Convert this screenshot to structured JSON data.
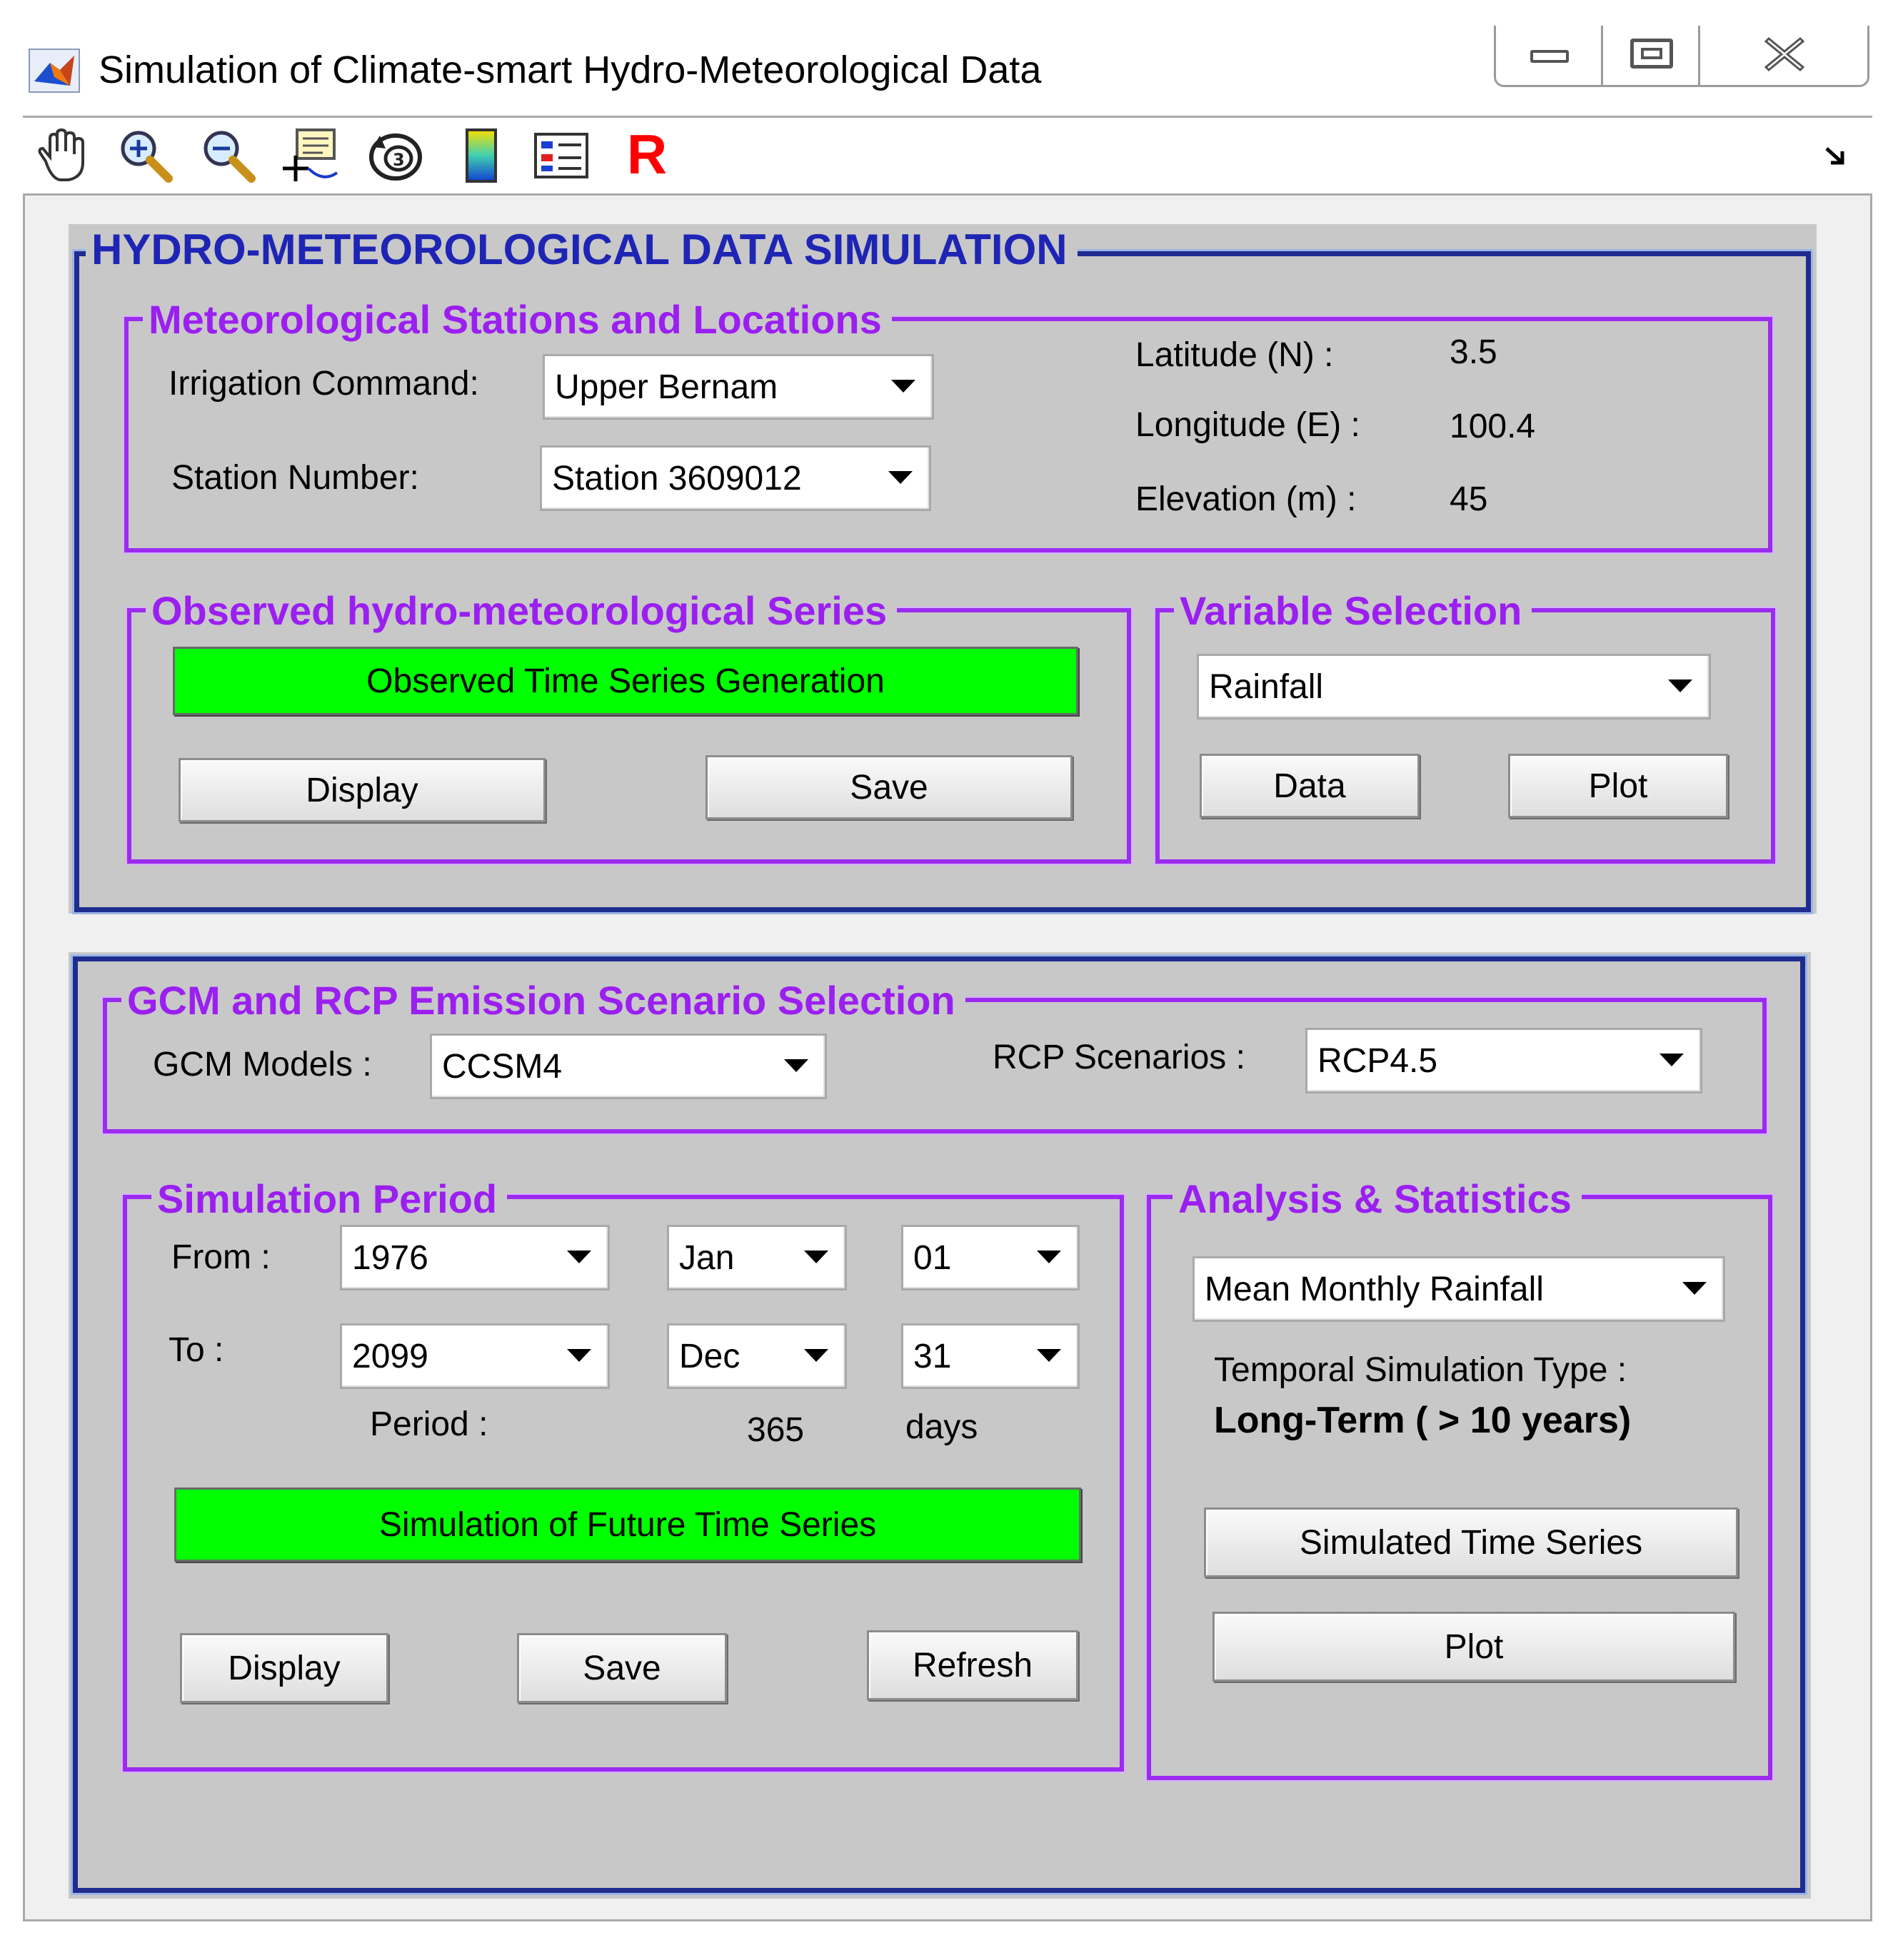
{
  "window": {
    "title": "Simulation of Climate-smart Hydro-Meteorological Data",
    "app_icon": "matlab-icon",
    "controls": [
      "minimize-icon",
      "maximize-icon",
      "close-icon"
    ]
  },
  "toolbar": {
    "tools": [
      "pan-hand-icon",
      "zoom-in-icon",
      "zoom-out-icon",
      "data-cursor-icon",
      "rotate-3d-icon",
      "colorbar-icon",
      "legend-icon",
      "r-icon"
    ],
    "r_label": "R",
    "dock_icon": "dock-arrow-icon"
  },
  "hydro": {
    "title": "HYDRO-METEOROLOGICAL DATA SIMULATION",
    "stations": {
      "title": "Meteorological Stations and Locations",
      "irrigation_label": "Irrigation Command:",
      "irrigation_value": "Upper Bernam",
      "station_label": "Station Number:",
      "station_value": "Station 3609012",
      "latitude_label": "Latitude (N) :",
      "latitude_value": "3.5",
      "longitude_label": "Longitude (E) :",
      "longitude_value": "100.4",
      "elevation_label": "Elevation (m) :",
      "elevation_value": "45"
    },
    "observed": {
      "title": "Observed hydro-meteorological Series",
      "generate_label": "Observed Time Series Generation",
      "display_label": "Display",
      "save_label": "Save"
    },
    "variable": {
      "title": "Variable Selection",
      "selected": "Rainfall",
      "data_label": "Data",
      "plot_label": "Plot"
    }
  },
  "scenario": {
    "gcm_rcp": {
      "title": "GCM and RCP Emission Scenario Selection",
      "gcm_label": "GCM Models :",
      "gcm_value": "CCSM4",
      "rcp_label": "RCP Scenarios :",
      "rcp_value": "RCP4.5"
    },
    "period": {
      "title": "Simulation Period",
      "from_label": "From :",
      "from_year": "1976",
      "from_month": "Jan",
      "from_day": "01",
      "to_label": "To :",
      "to_year": "2099",
      "to_month": "Dec",
      "to_day": "31",
      "period_label": "Period :",
      "period_value": "365",
      "period_unit": "days",
      "simulate_label": "Simulation of Future Time Series",
      "display_label": "Display",
      "save_label": "Save",
      "refresh_label": "Refresh"
    },
    "analysis": {
      "title": "Analysis & Statistics",
      "statistic": "Mean Monthly Rainfall",
      "temporal_label": "Temporal Simulation Type :",
      "temporal_value": "Long-Term ( > 10 years)",
      "simulated_label": "Simulated Time Series",
      "plot_label": "Plot"
    }
  },
  "colors": {
    "panel_border": "#1f2c8f",
    "panel_title": "#1e25b4",
    "subpanel_border": "#9c2bf0",
    "subpanel_title": "#9b1ff0",
    "green_button": "#00ff00",
    "background": "#c8c8c8"
  }
}
